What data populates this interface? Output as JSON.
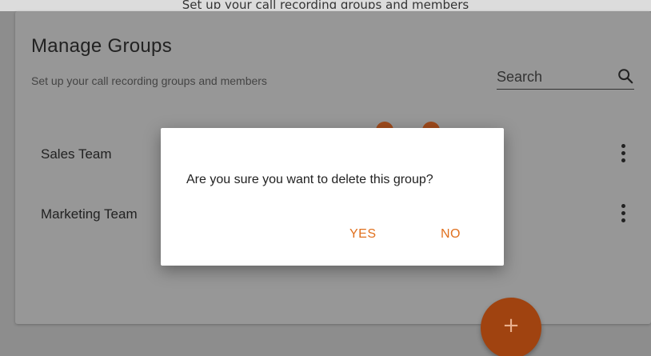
{
  "page": {
    "top_caption": "Set up your call recording groups and members"
  },
  "header": {
    "title": "Manage Groups",
    "subtitle": "Set up your call recording groups and members"
  },
  "search": {
    "placeholder": "Search",
    "icon": "search-icon"
  },
  "groups": [
    {
      "name": "Sales Team",
      "menu_icon": "kebab-menu-icon"
    },
    {
      "name": "Marketing Team",
      "menu_icon": "kebab-menu-icon"
    }
  ],
  "fab": {
    "label": "+",
    "icon": "plus-icon"
  },
  "dialog": {
    "message": "Are you sure you want to delete this group?",
    "yes_label": "YES",
    "no_label": "NO"
  },
  "colors": {
    "accent": "#E86F1A",
    "overlay": "#8D8D8D"
  }
}
